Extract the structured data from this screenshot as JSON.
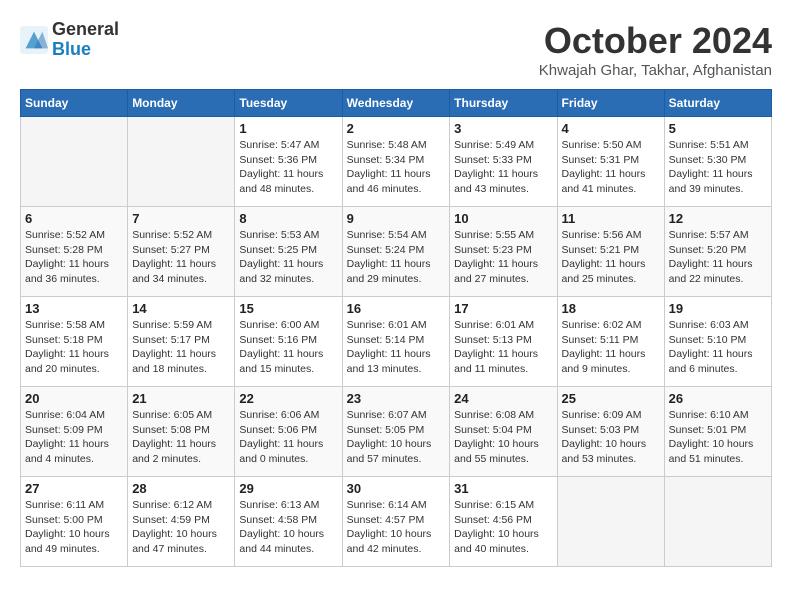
{
  "header": {
    "logo_general": "General",
    "logo_blue": "Blue",
    "month": "October 2024",
    "location": "Khwajah Ghar, Takhar, Afghanistan"
  },
  "weekdays": [
    "Sunday",
    "Monday",
    "Tuesday",
    "Wednesday",
    "Thursday",
    "Friday",
    "Saturday"
  ],
  "weeks": [
    [
      {
        "day": null
      },
      {
        "day": null
      },
      {
        "day": "1",
        "sunrise": "5:47 AM",
        "sunset": "5:36 PM",
        "daylight": "11 hours and 48 minutes."
      },
      {
        "day": "2",
        "sunrise": "5:48 AM",
        "sunset": "5:34 PM",
        "daylight": "11 hours and 46 minutes."
      },
      {
        "day": "3",
        "sunrise": "5:49 AM",
        "sunset": "5:33 PM",
        "daylight": "11 hours and 43 minutes."
      },
      {
        "day": "4",
        "sunrise": "5:50 AM",
        "sunset": "5:31 PM",
        "daylight": "11 hours and 41 minutes."
      },
      {
        "day": "5",
        "sunrise": "5:51 AM",
        "sunset": "5:30 PM",
        "daylight": "11 hours and 39 minutes."
      }
    ],
    [
      {
        "day": "6",
        "sunrise": "5:52 AM",
        "sunset": "5:28 PM",
        "daylight": "11 hours and 36 minutes."
      },
      {
        "day": "7",
        "sunrise": "5:52 AM",
        "sunset": "5:27 PM",
        "daylight": "11 hours and 34 minutes."
      },
      {
        "day": "8",
        "sunrise": "5:53 AM",
        "sunset": "5:25 PM",
        "daylight": "11 hours and 32 minutes."
      },
      {
        "day": "9",
        "sunrise": "5:54 AM",
        "sunset": "5:24 PM",
        "daylight": "11 hours and 29 minutes."
      },
      {
        "day": "10",
        "sunrise": "5:55 AM",
        "sunset": "5:23 PM",
        "daylight": "11 hours and 27 minutes."
      },
      {
        "day": "11",
        "sunrise": "5:56 AM",
        "sunset": "5:21 PM",
        "daylight": "11 hours and 25 minutes."
      },
      {
        "day": "12",
        "sunrise": "5:57 AM",
        "sunset": "5:20 PM",
        "daylight": "11 hours and 22 minutes."
      }
    ],
    [
      {
        "day": "13",
        "sunrise": "5:58 AM",
        "sunset": "5:18 PM",
        "daylight": "11 hours and 20 minutes."
      },
      {
        "day": "14",
        "sunrise": "5:59 AM",
        "sunset": "5:17 PM",
        "daylight": "11 hours and 18 minutes."
      },
      {
        "day": "15",
        "sunrise": "6:00 AM",
        "sunset": "5:16 PM",
        "daylight": "11 hours and 15 minutes."
      },
      {
        "day": "16",
        "sunrise": "6:01 AM",
        "sunset": "5:14 PM",
        "daylight": "11 hours and 13 minutes."
      },
      {
        "day": "17",
        "sunrise": "6:01 AM",
        "sunset": "5:13 PM",
        "daylight": "11 hours and 11 minutes."
      },
      {
        "day": "18",
        "sunrise": "6:02 AM",
        "sunset": "5:11 PM",
        "daylight": "11 hours and 9 minutes."
      },
      {
        "day": "19",
        "sunrise": "6:03 AM",
        "sunset": "5:10 PM",
        "daylight": "11 hours and 6 minutes."
      }
    ],
    [
      {
        "day": "20",
        "sunrise": "6:04 AM",
        "sunset": "5:09 PM",
        "daylight": "11 hours and 4 minutes."
      },
      {
        "day": "21",
        "sunrise": "6:05 AM",
        "sunset": "5:08 PM",
        "daylight": "11 hours and 2 minutes."
      },
      {
        "day": "22",
        "sunrise": "6:06 AM",
        "sunset": "5:06 PM",
        "daylight": "11 hours and 0 minutes."
      },
      {
        "day": "23",
        "sunrise": "6:07 AM",
        "sunset": "5:05 PM",
        "daylight": "10 hours and 57 minutes."
      },
      {
        "day": "24",
        "sunrise": "6:08 AM",
        "sunset": "5:04 PM",
        "daylight": "10 hours and 55 minutes."
      },
      {
        "day": "25",
        "sunrise": "6:09 AM",
        "sunset": "5:03 PM",
        "daylight": "10 hours and 53 minutes."
      },
      {
        "day": "26",
        "sunrise": "6:10 AM",
        "sunset": "5:01 PM",
        "daylight": "10 hours and 51 minutes."
      }
    ],
    [
      {
        "day": "27",
        "sunrise": "6:11 AM",
        "sunset": "5:00 PM",
        "daylight": "10 hours and 49 minutes."
      },
      {
        "day": "28",
        "sunrise": "6:12 AM",
        "sunset": "4:59 PM",
        "daylight": "10 hours and 47 minutes."
      },
      {
        "day": "29",
        "sunrise": "6:13 AM",
        "sunset": "4:58 PM",
        "daylight": "10 hours and 44 minutes."
      },
      {
        "day": "30",
        "sunrise": "6:14 AM",
        "sunset": "4:57 PM",
        "daylight": "10 hours and 42 minutes."
      },
      {
        "day": "31",
        "sunrise": "6:15 AM",
        "sunset": "4:56 PM",
        "daylight": "10 hours and 40 minutes."
      },
      {
        "day": null
      },
      {
        "day": null
      }
    ]
  ],
  "labels": {
    "sunrise": "Sunrise:",
    "sunset": "Sunset:",
    "daylight": "Daylight:"
  },
  "colors": {
    "header_bg": "#2a6db5",
    "accent": "#1a7fc1"
  }
}
